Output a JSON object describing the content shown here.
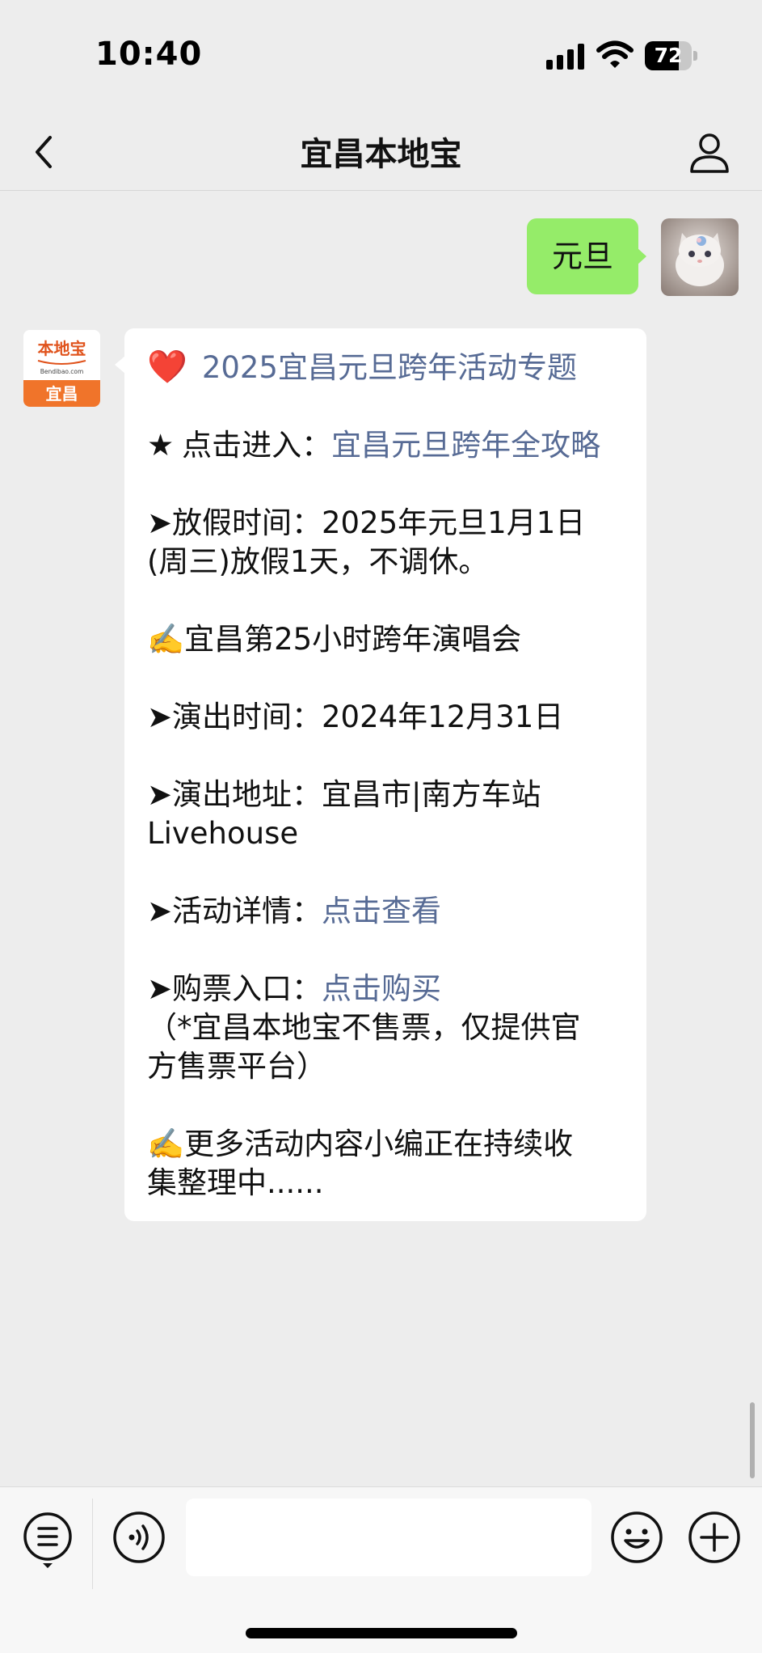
{
  "status_bar": {
    "time": "10:40",
    "battery_level": "72",
    "battery_fraction": 0.72,
    "icons": [
      "signal-icon",
      "wifi-icon",
      "battery-icon"
    ]
  },
  "nav": {
    "title": "宜昌本地宝",
    "back_icon": "chevron-left-icon",
    "profile_icon": "person-icon"
  },
  "messages": {
    "outgoing": {
      "text": "元旦"
    },
    "incoming": {
      "avatar": {
        "top_text": "本地宝",
        "sub_text": "Bendibao.com",
        "bottom_text": "宜昌"
      },
      "heading": "2025宜昌元旦跨年活动专题",
      "entry_prefix": "点击进入：",
      "entry_link": "宜昌元旦跨年全攻略",
      "holiday_line1": "➤放假时间：2025年元旦1月1日",
      "holiday_line2": "(周三)放假1天，不调休。",
      "concert_title": "宜昌第25小时跨年演唱会",
      "show_time": "➤演出时间：2024年12月31日",
      "show_addr_line1": "➤演出地址：宜昌市|南方车站",
      "show_addr_line2": "Livehouse",
      "details_prefix": "➤活动详情：",
      "details_link": "点击查看",
      "ticket_prefix": "➤购票入口：",
      "ticket_link": "点击购买",
      "ticket_note_line1": "（*宜昌本地宝不售票，仅提供官",
      "ticket_note_line2": "方售票平台）",
      "more_line1": "更多活动内容小编正在持续收",
      "more_line2": "集整理中......"
    }
  },
  "toolbar": {
    "input_value": "",
    "icons": [
      "menu-list-icon",
      "voice-icon",
      "emoji-icon",
      "add-icon"
    ]
  },
  "colors": {
    "background": "#ededed",
    "outgoing_bubble": "#95ec69",
    "incoming_bubble": "#ffffff",
    "link": "#576b95",
    "brand_orange": "#f0742a"
  }
}
